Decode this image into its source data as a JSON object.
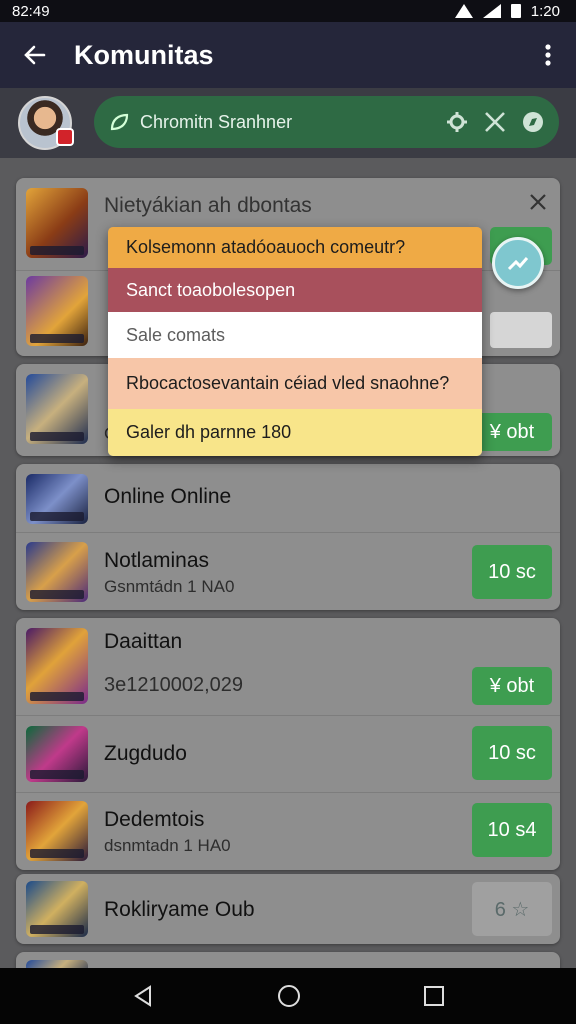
{
  "status_bar": {
    "time": "82:49",
    "time_right": "1:20"
  },
  "app_bar": {
    "title": "Komunitas"
  },
  "search": {
    "text": "Chromitn Sranhner"
  },
  "cards": {
    "c1": {
      "title": "Nietyákian ah dbontas",
      "btn1": "",
      "btn2": ""
    },
    "c2": {
      "sub": "C",
      "btn": "¥ obt"
    },
    "c3": {
      "r1_title": "Online Online",
      "r2_title": "Notlaminas",
      "r2_sub": "Gsnmtádn 1 NA0",
      "r2_btn": "10 sc"
    },
    "c4": {
      "r1_title": "Daaittan",
      "r1_sub": "3e1210002,029",
      "r1_btn": "¥ obt",
      "r2_title": "Zugdudo",
      "r2_btn": "10 sc",
      "r3_title": "Dedemtois",
      "r3_sub": "dsnmtadn 1 HA0",
      "r3_btn": "10 s4"
    },
    "c5": {
      "title": "Rokliryame Oub",
      "btn": "6 ☆"
    }
  },
  "popup": {
    "options": [
      "Kolsemonn atadóoauoch comeutr?",
      "Sanct toaobolesopen",
      "Sale comats",
      "Rbocactosevantain céiad vled snaohne?",
      "Galer dh parnne 180"
    ]
  },
  "colors": {
    "accent_green": "#3e9d50",
    "app_bar": "#25263a",
    "search_pill": "#2e6a44"
  }
}
